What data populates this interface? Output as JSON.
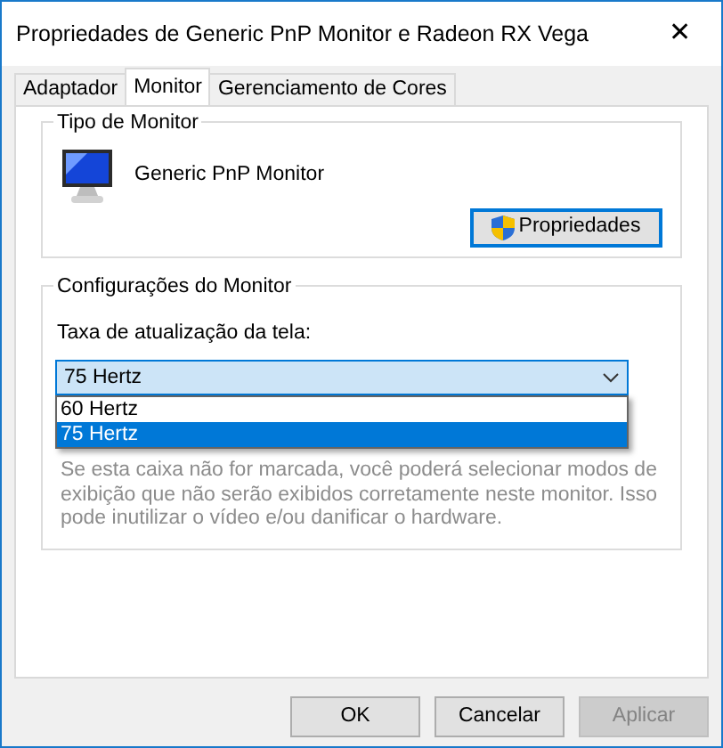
{
  "window": {
    "title": "Propriedades de Generic PnP Monitor e Radeon RX Vega",
    "close": "✕"
  },
  "tabs": [
    {
      "label": "Adaptador",
      "selected": false
    },
    {
      "label": "Monitor",
      "selected": true
    },
    {
      "label": "Gerenciamento de Cores",
      "selected": false
    }
  ],
  "monitor_type": {
    "legend": "Tipo de Monitor",
    "name": "Generic PnP Monitor",
    "button": "Propriedades"
  },
  "monitor_settings": {
    "legend": "Configurações do Monitor",
    "label": "Taxa de atualização da tela:",
    "value": "75 Hertz",
    "expanded": true,
    "options": [
      {
        "label": "60 Hertz",
        "selected": false
      },
      {
        "label": "75 Hertz",
        "selected": true
      }
    ],
    "hint": "Se esta caixa não for marcada, você poderá selecionar modos de exibição que não serão exibidos corretamente neste monitor. Isso pode inutilizar o vídeo e/ou danificar o hardware."
  },
  "buttons": [
    {
      "label": "OK",
      "disabled": false
    },
    {
      "label": "Cancelar",
      "disabled": false
    },
    {
      "label": "Aplicar",
      "disabled": true
    }
  ]
}
